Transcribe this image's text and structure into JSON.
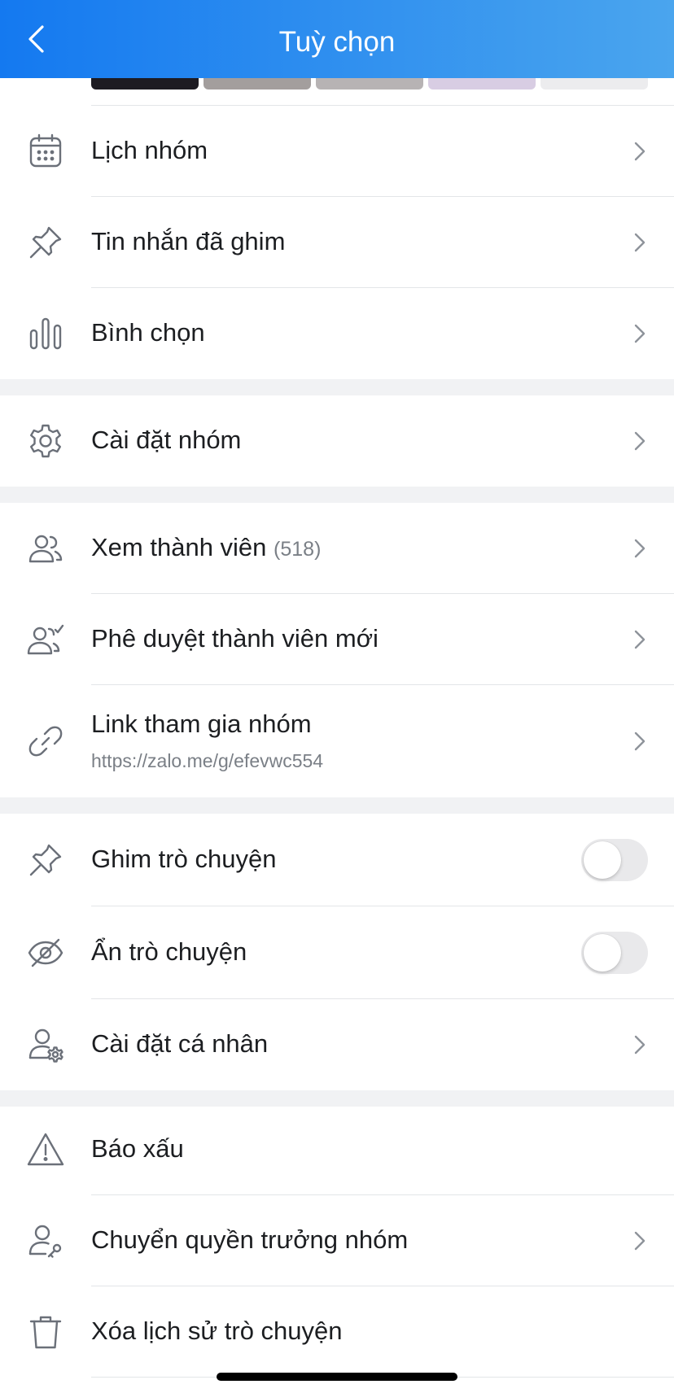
{
  "header": {
    "title": "Tuỳ chọn",
    "back_icon": "chevron-left-icon"
  },
  "sections": [
    {
      "items": [
        {
          "label": "Lịch nhóm",
          "icon": "calendar-icon",
          "chevron": true
        },
        {
          "label": "Tin nhắn đã ghim",
          "icon": "pin-icon",
          "chevron": true
        },
        {
          "label": "Bình chọn",
          "icon": "poll-icon",
          "chevron": true
        }
      ]
    },
    {
      "items": [
        {
          "label": "Cài đặt nhóm",
          "icon": "gear-icon",
          "chevron": true
        }
      ]
    },
    {
      "items": [
        {
          "label": "Xem thành viên",
          "count": "(518)",
          "icon": "members-icon",
          "chevron": true
        },
        {
          "label": "Phê duyệt thành viên mới",
          "icon": "approve-members-icon",
          "chevron": true
        },
        {
          "label": "Link tham gia nhóm",
          "subtitle": "https://zalo.me/g/efevwc554",
          "icon": "link-icon",
          "chevron": true
        }
      ]
    },
    {
      "items": [
        {
          "label": "Ghim trò chuyện",
          "icon": "pin-icon",
          "toggle": false
        },
        {
          "label": "Ẩn trò chuyện",
          "icon": "eye-off-icon",
          "toggle": false
        },
        {
          "label": "Cài đặt cá nhân",
          "icon": "user-settings-icon",
          "chevron": true
        }
      ]
    },
    {
      "items": [
        {
          "label": "Báo xấu",
          "icon": "warning-icon",
          "chevron": false
        },
        {
          "label": "Chuyển quyền trưởng nhóm",
          "icon": "transfer-owner-icon",
          "chevron": true
        },
        {
          "label": "Xóa lịch sử trò chuyện",
          "icon": "trash-icon",
          "chevron": false
        }
      ]
    }
  ],
  "colors": {
    "header_gradient_start": "#1479f0",
    "header_gradient_end": "#4aa5ee",
    "icon_gray": "#6b7079",
    "chevron_gray": "#8e939a",
    "separator": "#f1f2f4",
    "toggle_off": "#e9e9eb"
  }
}
